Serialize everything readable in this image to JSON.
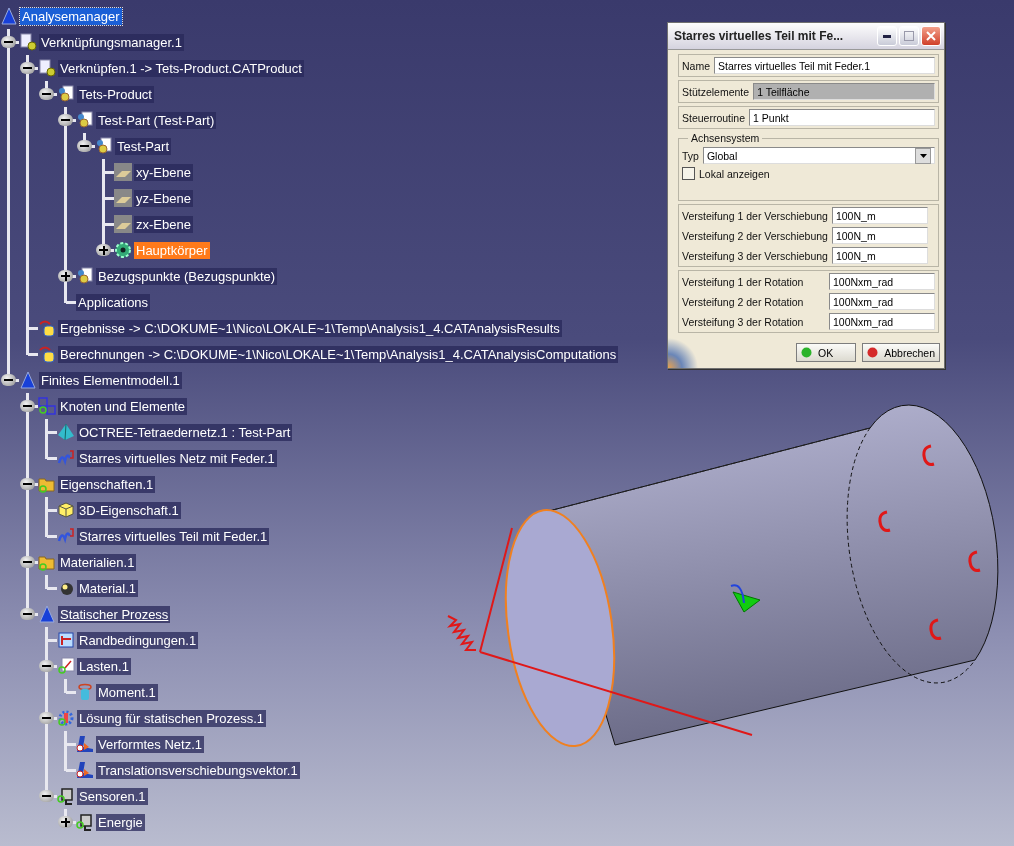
{
  "tree": [
    {
      "label": "Analysemanager",
      "kind": "analysis",
      "selected": true,
      "children": [
        {
          "label": "Verknüpfungsmanager.1",
          "kind": "link",
          "selected": false,
          "expanded": true,
          "children": [
            {
              "label": "Verknüpfen.1 -> Tets-Product.CATProduct",
              "kind": "link",
              "selected": false,
              "expanded": true,
              "children": [
                {
                  "label": "Tets-Product",
                  "kind": "product",
                  "selected": false,
                  "expanded": true,
                  "children": [
                    {
                      "label": "Test-Part (Test-Part)",
                      "kind": "product",
                      "selected": false,
                      "expanded": true,
                      "children": [
                        {
                          "label": "Test-Part",
                          "kind": "product",
                          "selected": false,
                          "expanded": true,
                          "children": [
                            {
                              "label": "xy-Ebene",
                              "kind": "plane",
                              "selected": false
                            },
                            {
                              "label": "yz-Ebene",
                              "kind": "plane",
                              "selected": false
                            },
                            {
                              "label": "zx-Ebene",
                              "kind": "plane",
                              "selected": false
                            },
                            {
                              "label": "Hauptkörper",
                              "kind": "body",
                              "selected": false,
                              "highlighted": true,
                              "expanded": false
                            }
                          ]
                        }
                      ]
                    },
                    {
                      "label": "Bezugspunkte (Bezugspunkte)",
                      "kind": "product",
                      "selected": false,
                      "expanded": false
                    },
                    {
                      "label": "Applications",
                      "kind": "none",
                      "selected": false
                    }
                  ]
                }
              ]
            },
            {
              "label": "Ergebnisse -> C:\\DOKUME~1\\Nico\\LOKALE~1\\Temp\\Analysis1_4.CATAnalysisResults",
              "kind": "database",
              "selected": false
            },
            {
              "label": "Berechnungen -> C:\\DOKUME~1\\Nico\\LOKALE~1\\Temp\\Analysis1_4.CATAnalysisComputations",
              "kind": "database",
              "selected": false
            }
          ]
        },
        {
          "label": "Finites Elementmodell.1",
          "kind": "analysis",
          "selected": false,
          "expanded": true,
          "children": [
            {
              "label": "Knoten und Elemente",
              "kind": "mesh",
              "selected": false,
              "expanded": true,
              "children": [
                {
                  "label": "OCTREE-Tetraedernetz.1 : Test-Part",
                  "kind": "pyramid",
                  "selected": false
                },
                {
                  "label": "Starres virtuelles Netz mit Feder.1",
                  "kind": "spring",
                  "selected": false
                }
              ]
            },
            {
              "label": "Eigenschaften.1",
              "kind": "folder",
              "selected": false,
              "expanded": true,
              "children": [
                {
                  "label": "3D-Eigenschaft.1",
                  "kind": "cube",
                  "selected": false
                },
                {
                  "label": "Starres virtuelles Teil mit Feder.1",
                  "kind": "spring",
                  "selected": false
                }
              ]
            },
            {
              "label": "Materialien.1",
              "kind": "folder",
              "selected": false,
              "expanded": true,
              "children": [
                {
                  "label": "Material.1",
                  "kind": "ball",
                  "selected": false
                }
              ]
            },
            {
              "label": "Statischer Prozess",
              "kind": "analysis",
              "selected": false,
              "current": true,
              "expanded": true,
              "children": [
                {
                  "label": "Randbedingungen.1",
                  "kind": "flag",
                  "selected": false
                },
                {
                  "label": "Lasten.1",
                  "kind": "loads",
                  "selected": false,
                  "expanded": true,
                  "children": [
                    {
                      "label": "Moment.1",
                      "kind": "cylinder",
                      "selected": false
                    }
                  ]
                },
                {
                  "label": "Lösung für statischen Prozess.1",
                  "kind": "solution",
                  "selected": false,
                  "expanded": true,
                  "children": [
                    {
                      "label": "Verformtes Netz.1",
                      "kind": "image",
                      "selected": false
                    },
                    {
                      "label": "Translationsverschiebungsvektor.1",
                      "kind": "image",
                      "selected": false
                    }
                  ]
                },
                {
                  "label": "Sensoren.1",
                  "kind": "sensor",
                  "selected": false,
                  "expanded": true,
                  "children": [
                    {
                      "label": "Energie",
                      "kind": "sensor",
                      "selected": false,
                      "expanded": false
                    }
                  ]
                }
              ]
            }
          ]
        }
      ]
    }
  ],
  "dialog": {
    "title": "Starres virtuelles Teil mit Fe...",
    "name": {
      "label": "Name",
      "value": "Starres virtuelles Teil mit Feder.1"
    },
    "supports": {
      "label": "Stützelemente",
      "value": "1 Teilfläche",
      "disabled": true
    },
    "handler": {
      "label": "Steuerroutine",
      "value": "1 Punkt",
      "disabled": false
    },
    "axis_group": {
      "title": "Achsensystem",
      "type_label": "Typ",
      "type_value": "Global",
      "checkbox": {
        "label": "Lokal anzeigen",
        "checked": false
      }
    },
    "translation": [
      {
        "label": "Versteifung 1 der Verschiebung",
        "value": "100N_m"
      },
      {
        "label": "Versteifung 2 der Verschiebung",
        "value": "100N_m"
      },
      {
        "label": "Versteifung 3 der Verschiebung",
        "value": "100N_m"
      }
    ],
    "rotation": [
      {
        "label": "Versteifung 1 der Rotation",
        "value": "100Nxm_rad"
      },
      {
        "label": "Versteifung 2 der Rotation",
        "value": "100Nxm_rad"
      },
      {
        "label": "Versteifung 3 der Rotation",
        "value": "100Nxm_rad"
      }
    ],
    "buttons": [
      {
        "label": "OK",
        "kind": "ok"
      },
      {
        "label": "Abbrechen",
        "kind": "cancel"
      }
    ]
  }
}
